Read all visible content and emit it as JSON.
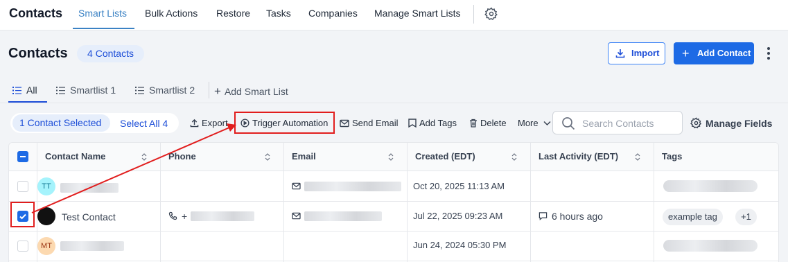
{
  "nav": {
    "title": "Contacts",
    "items": [
      "Smart Lists",
      "Bulk Actions",
      "Restore",
      "Tasks",
      "Companies",
      "Manage Smart Lists"
    ]
  },
  "header": {
    "title": "Contacts",
    "count_badge": "4 Contacts",
    "import_label": "Import",
    "add_contact_label": "Add Contact"
  },
  "tabs": [
    "All",
    "Smartlist 1",
    "Smartlist 2",
    "Add Smart List"
  ],
  "toolbar": {
    "selected_label": "1 Contact Selected",
    "select_all_label": "Select All 4",
    "export_label": "Export",
    "trigger_label": "Trigger Automation",
    "send_email_label": "Send Email",
    "add_tags_label": "Add Tags",
    "delete_label": "Delete",
    "more_label": "More",
    "search_placeholder": "Search Contacts",
    "manage_fields_label": "Manage Fields"
  },
  "table": {
    "columns": [
      "Contact Name",
      "Phone",
      "Email",
      "Created (EDT)",
      "Last Activity (EDT)",
      "Tags"
    ],
    "rows": [
      {
        "initials": "TT",
        "name": "",
        "phone_prefix": "",
        "created": "Oct 20, 2025 11:13 AM",
        "last_activity": "",
        "tags": [],
        "checked": false
      },
      {
        "initials": "",
        "name": "Test Contact",
        "phone_prefix": "+",
        "created": "Jul 22, 2025 09:23 AM",
        "last_activity": "6 hours ago",
        "tags": [
          "example tag",
          "+1"
        ],
        "checked": true
      },
      {
        "initials": "MT",
        "name": "",
        "phone_prefix": "",
        "created": "Jun 24, 2024 05:30 PM",
        "last_activity": "",
        "tags": [],
        "checked": false
      }
    ]
  },
  "colors": {
    "accent": "#1d6ae5",
    "nav_active": "#3b82c4",
    "highlight": "#e11d1d",
    "avatar_tt": "#a5f3fc",
    "avatar_mt": "#fcd9b0"
  }
}
